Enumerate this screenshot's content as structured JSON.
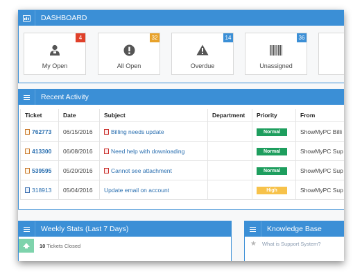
{
  "dashboard": {
    "title": "DASHBOARD",
    "tiles": [
      {
        "label": "My Open",
        "count": "4",
        "badge_color": "#e0402a",
        "icon": "user-icon"
      },
      {
        "label": "All Open",
        "count": "32",
        "badge_color": "#e8a22a",
        "icon": "exclamation-circle-icon"
      },
      {
        "label": "Overdue",
        "count": "14",
        "badge_color": "#3b8fd6",
        "icon": "warning-icon"
      },
      {
        "label": "Unassigned",
        "count": "36",
        "badge_color": "#3b8fd6",
        "icon": "barcode-icon"
      }
    ]
  },
  "recent_activity": {
    "title": "Recent Activity",
    "columns": [
      "Ticket",
      "Date",
      "Subject",
      "Department",
      "Priority",
      "From"
    ],
    "rows": [
      {
        "ticket": "762773",
        "date": "06/15/2016",
        "subject": "Billing needs update",
        "department": "",
        "priority": "Normal",
        "from": "ShowMyPC Billi",
        "icon": "attachment-file-icon"
      },
      {
        "ticket": "413300",
        "date": "06/08/2016",
        "subject": "Need help with downloading",
        "department": "",
        "priority": "Normal",
        "from": "ShowMyPC Sup",
        "icon": "attachment-file-icon"
      },
      {
        "ticket": "539595",
        "date": "05/20/2016",
        "subject": "Cannot see attachment",
        "department": "",
        "priority": "Normal",
        "from": "ShowMyPC Sup",
        "icon": "attachment-file-icon"
      },
      {
        "ticket": "318913",
        "date": "05/04/2016",
        "subject": "Update email on account",
        "department": "",
        "priority": "High",
        "from": "ShowMyPC Sup",
        "icon": "document-icon"
      }
    ]
  },
  "weekly_stats": {
    "title": "Weekly Stats (Last 7 Days)",
    "count": "10",
    "label": "Tickets Closed"
  },
  "knowledge_base": {
    "title": "Knowledge Base",
    "first_item": "What is Support System?"
  },
  "colors": {
    "accent": "#3b8fd6",
    "normal": "#1e9e5e",
    "high": "#f7c24a"
  }
}
